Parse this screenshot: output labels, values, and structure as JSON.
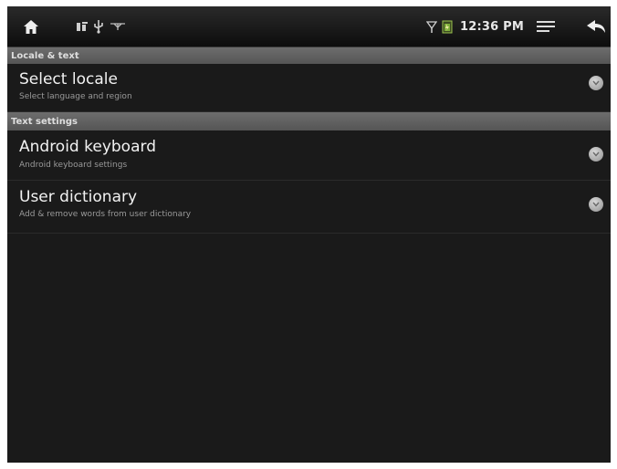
{
  "status_bar": {
    "time": "12:36 PM",
    "icons": [
      "home-icon",
      "notification-icon",
      "usb-icon",
      "wifi-icon",
      "battery-icon",
      "menu-icon",
      "back-icon"
    ]
  },
  "sections": [
    {
      "header": "Locale & text",
      "items": [
        {
          "title": "Select locale",
          "summary": "Select language and region"
        }
      ]
    },
    {
      "header": "Text settings",
      "items": [
        {
          "title": "Android keyboard",
          "summary": "Android keyboard settings"
        },
        {
          "title": "User dictionary",
          "summary": "Add & remove words from user dictionary"
        }
      ]
    }
  ],
  "colors": {
    "background": "#1a1a1a",
    "status_bar": "#111111",
    "section_header": "#5f5f5f",
    "battery_accent": "#7fae3a"
  }
}
